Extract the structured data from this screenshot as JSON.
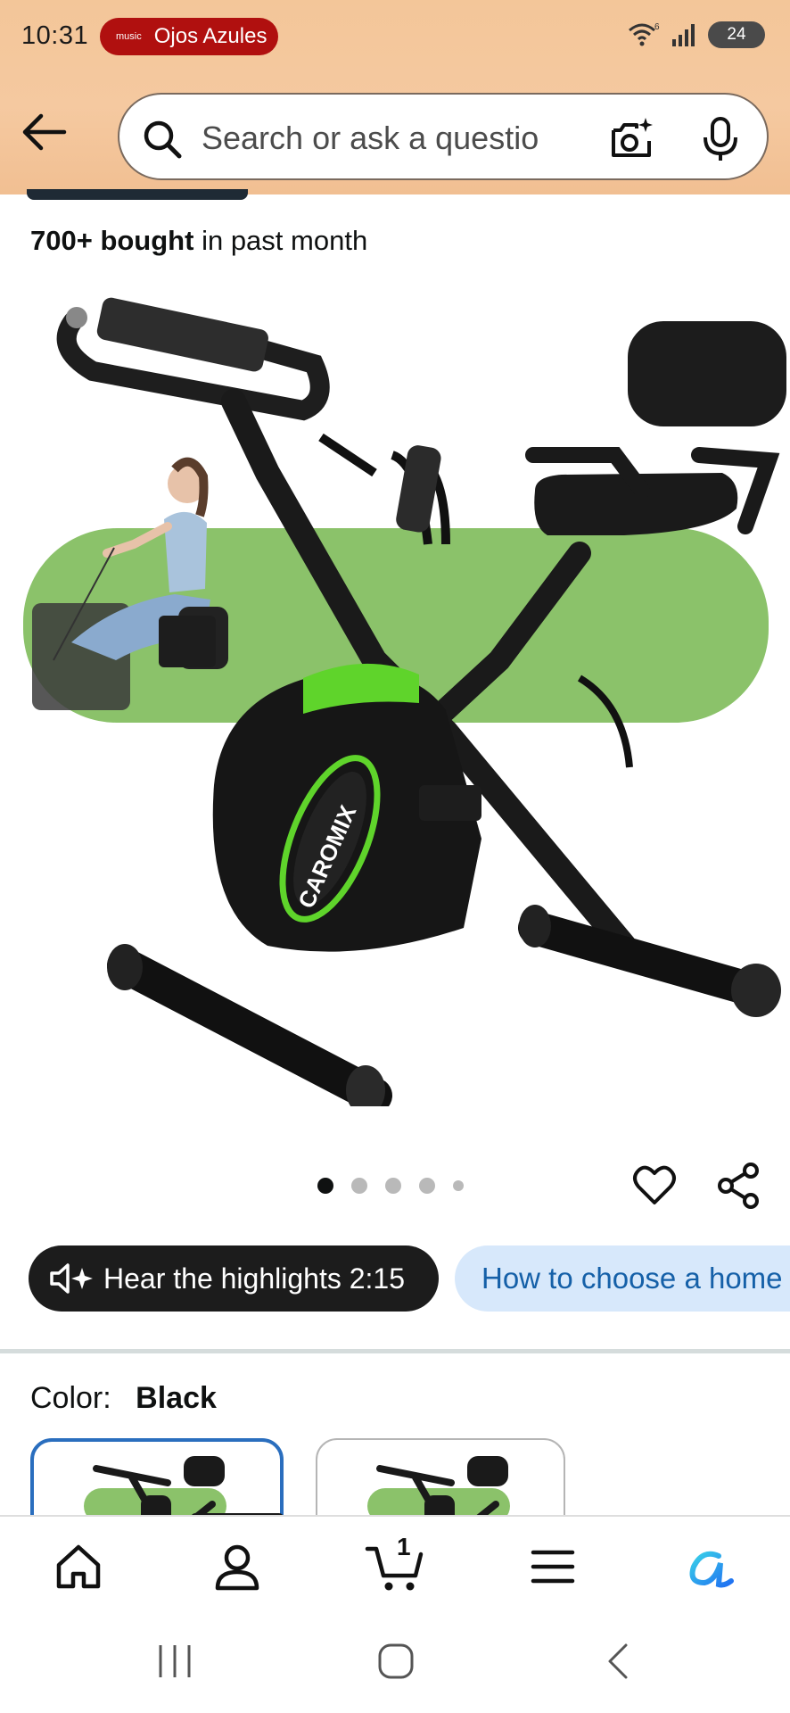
{
  "status_bar": {
    "time": "10:31",
    "now_playing_service": "music",
    "now_playing": "Ojos Azules",
    "network": "6",
    "battery": "24"
  },
  "header": {
    "search_placeholder": "Search or ask a question",
    "icons": [
      "back-arrow-icon",
      "search-icon",
      "camera-lens-icon",
      "microphone-icon"
    ]
  },
  "product": {
    "bought_strong": "700+ bought",
    "bought_rest": "in past month",
    "image_brand": "CAROMIX",
    "carousel": {
      "total": 5,
      "active_index": 0
    },
    "highlights_label": "Hear the highlights 2:15",
    "chip_label": "How to choose a home",
    "color_label": "Color:",
    "color_value": "Black"
  },
  "bottom_nav": {
    "items": [
      "home",
      "account",
      "cart",
      "menu",
      "rufus"
    ],
    "cart_count": "1"
  },
  "colors": {
    "header_bg": "#f3c699",
    "accent_green": "#8bc26a",
    "brand_green": "#5fd42b",
    "selected_border": "#2a6ebe",
    "chip_bg": "#d7e8fb",
    "chip_text": "#1560a8",
    "now_playing_bg": "#b0100f"
  }
}
